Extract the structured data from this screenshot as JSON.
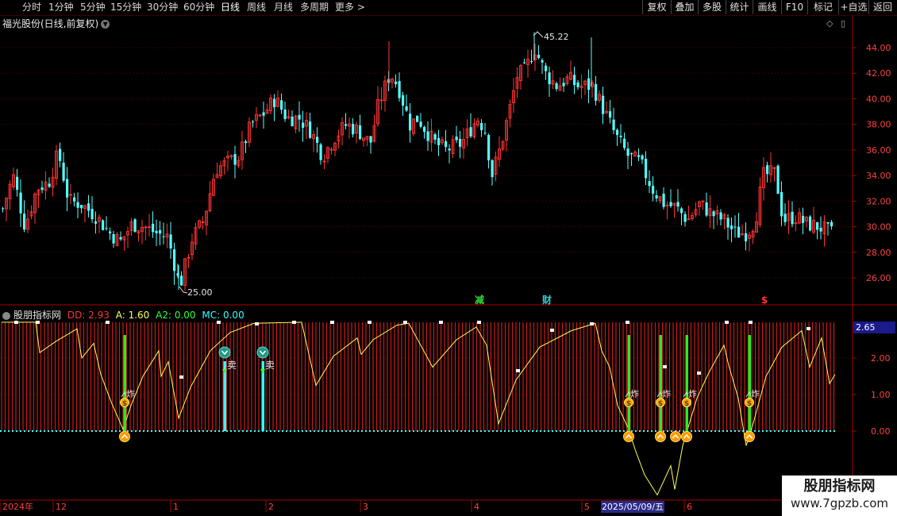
{
  "toolbar": {
    "periods": [
      "分时",
      "1分钟",
      "5分钟",
      "15分钟",
      "30分钟",
      "60分钟",
      "日线",
      "周线",
      "月线",
      "多周期",
      "更多 >"
    ],
    "active_period": "日线",
    "buttons": [
      "复权",
      "叠加",
      "多股",
      "统计",
      "画线",
      "F10",
      "标记",
      "+自选",
      "返回"
    ]
  },
  "stock": {
    "title": "福光股份(日线,前复权)"
  },
  "price_axis": {
    "ticks": [
      "44.00",
      "42.00",
      "40.00",
      "38.00",
      "36.00",
      "34.00",
      "32.00",
      "30.00",
      "28.00",
      "26.00"
    ]
  },
  "price_annotations": {
    "high": "45.22",
    "low": "25.00"
  },
  "event_markers": [
    {
      "label": "减",
      "color": "#33dd33"
    },
    {
      "label": "财",
      "color": "#33cccc"
    },
    {
      "label": "$",
      "color": "#ff3333"
    }
  ],
  "indicator": {
    "name": "股朋指标网",
    "values": [
      {
        "label": "DD: 2.93",
        "color": "#ff3333"
      },
      {
        "label": "A: 1.60",
        "color": "#ffff66"
      },
      {
        "label": "A2: 0.00",
        "color": "#33ff33"
      },
      {
        "label": "MC: 0.00",
        "color": "#33ffff"
      }
    ],
    "axis_ticks": [
      "2.00",
      "1.00",
      "0.00"
    ],
    "current_value": "2.65",
    "sell_label": "卖",
    "bomb_label": "炸"
  },
  "time_axis": {
    "labels": [
      "2024年",
      "12",
      "1",
      "2",
      "3",
      "4",
      "5",
      "6"
    ],
    "selected_date": "2025/05/09/五"
  },
  "watermark": {
    "title": "股朋指标网",
    "url": "www.7gpzb.com"
  },
  "colors": {
    "up": "#ff3333",
    "down": "#54ffff",
    "axis": "#aa0000",
    "grid": "#660000"
  },
  "chart_data": {
    "type": "candlestick",
    "title": "福光股份(日线,前复权)",
    "ylim": [
      24.5,
      46
    ],
    "high_label": 45.22,
    "low_label": 25.0,
    "indicator_ylim": [
      -1.75,
      3.0
    ],
    "indicator_series": [
      "DD",
      "A",
      "A2",
      "MC"
    ]
  }
}
